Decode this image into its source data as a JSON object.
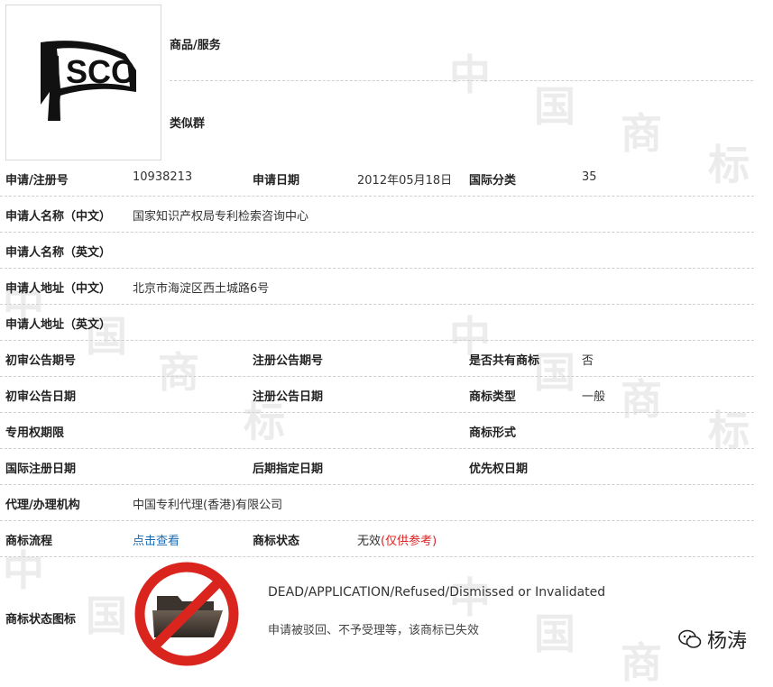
{
  "goods_services_label": "商品/服务",
  "similar_group_label": "类似群",
  "logo": {
    "text": "SCC"
  },
  "watermark_chars": [
    "中",
    "国",
    "商",
    "标"
  ],
  "rows": {
    "r1": {
      "l1": "申请/注册号",
      "v1": "10938213",
      "l2": "申请日期",
      "v2": "2012年05月18日",
      "l3": "国际分类",
      "v3": "35"
    },
    "r2": {
      "l1": "申请人名称（中文）",
      "v1": "国家知识产权局专利检索咨询中心"
    },
    "r3": {
      "l1": "申请人名称（英文）"
    },
    "r4": {
      "l1": "申请人地址（中文）",
      "v1": "北京市海淀区西土城路6号"
    },
    "r5": {
      "l1": "申请人地址（英文）"
    },
    "r6": {
      "l1": "初审公告期号",
      "l2": "注册公告期号",
      "l3": "是否共有商标",
      "v3": "否"
    },
    "r7": {
      "l1": "初审公告日期",
      "l2": "注册公告日期",
      "l3": "商标类型",
      "v3": "一般"
    },
    "r8": {
      "l1": "专用权期限",
      "l3": "商标形式"
    },
    "r9": {
      "l1": "国际注册日期",
      "l2": "后期指定日期",
      "l3": "优先权日期"
    },
    "r10": {
      "l1": "代理/办理机构",
      "v1": "中国专利代理(香港)有限公司"
    },
    "r11": {
      "l1": "商标流程",
      "v1": "点击查看",
      "l2": "商标状态",
      "v2": "无效",
      "v2_note": "(仅供参考)"
    }
  },
  "status": {
    "label": "商标状态图标",
    "en": "DEAD/APPLICATION/Refused/Dismissed or Invalidated",
    "cn": "申请被驳回、不予受理等，该商标已失效",
    "icon": "prohibited-folder-icon"
  },
  "wechat": {
    "name": "杨涛",
    "icon": "wechat-icon"
  },
  "colors": {
    "link": "#1a6bb5",
    "alert": "#dd2222",
    "prohibit": "#d9251d"
  }
}
